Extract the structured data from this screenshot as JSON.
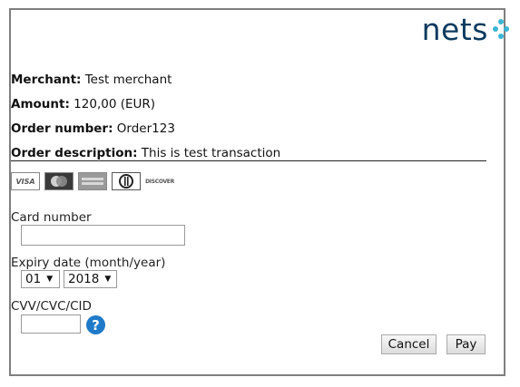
{
  "brand": {
    "logo_text": "nets",
    "accent_color": "#39b6d6",
    "text_color": "#0b3a5e"
  },
  "order": {
    "merchant_label": "Merchant:",
    "merchant_value": "Test merchant",
    "amount_label": "Amount:",
    "amount_value": "120,00 (EUR)",
    "order_number_label": "Order number:",
    "order_number_value": "Order123",
    "description_label": "Order description:",
    "description_value": "This is test transaction"
  },
  "card_logos": [
    {
      "name": "visa",
      "text": "VISA"
    },
    {
      "name": "mastercard",
      "text": ""
    },
    {
      "name": "american-express",
      "text": ""
    },
    {
      "name": "diners-club",
      "text": ""
    },
    {
      "name": "discover",
      "text": "DISCOVER"
    }
  ],
  "form": {
    "card_number_label": "Card number",
    "card_number_value": "",
    "expiry_label": "Expiry date (month/year)",
    "expiry_month": "01",
    "expiry_year": "2018",
    "cvv_label": "CVV/CVC/CID",
    "cvv_value": "",
    "help_icon": "?"
  },
  "actions": {
    "cancel_label": "Cancel",
    "pay_label": "Pay"
  }
}
